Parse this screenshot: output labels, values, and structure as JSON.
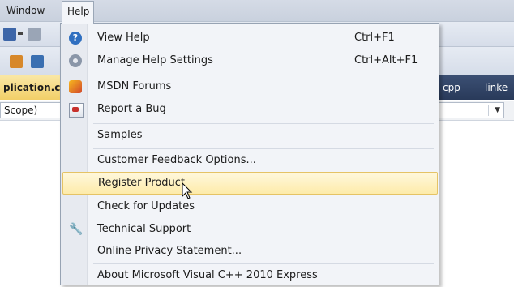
{
  "menubar": {
    "window_label": "Window",
    "help_label": "Help"
  },
  "tabs": {
    "active_label": "plication.c",
    "cpp_label": "cpp",
    "linke_label": "linke"
  },
  "scope": {
    "combo_text": "Scope)"
  },
  "help_menu": {
    "items": [
      {
        "label": "View Help",
        "shortcut": "Ctrl+F1",
        "icon": "help-circle-icon"
      },
      {
        "label": "Manage Help Settings",
        "shortcut": "Ctrl+Alt+F1",
        "icon": "gear-icon"
      },
      {
        "label": "MSDN Forums",
        "shortcut": "",
        "icon": "forums-icon"
      },
      {
        "label": "Report a Bug",
        "shortcut": "",
        "icon": "bug-report-icon"
      },
      {
        "label": "Samples",
        "shortcut": "",
        "icon": ""
      },
      {
        "label": "Customer Feedback Options...",
        "shortcut": "",
        "icon": ""
      },
      {
        "label": "Register Product",
        "shortcut": "",
        "icon": "",
        "highlighted": true
      },
      {
        "label": "Check for Updates",
        "shortcut": "",
        "icon": ""
      },
      {
        "label": "Technical Support",
        "shortcut": "",
        "icon": "support-icon"
      },
      {
        "label": "Online Privacy Statement...",
        "shortcut": "",
        "icon": ""
      },
      {
        "label": "About Microsoft Visual C++ 2010 Express",
        "shortcut": "",
        "icon": ""
      }
    ]
  },
  "colors": {
    "highlight": "#fdebaa",
    "tab_bar": "#293a5a",
    "active_tab": "#f2cf68"
  }
}
